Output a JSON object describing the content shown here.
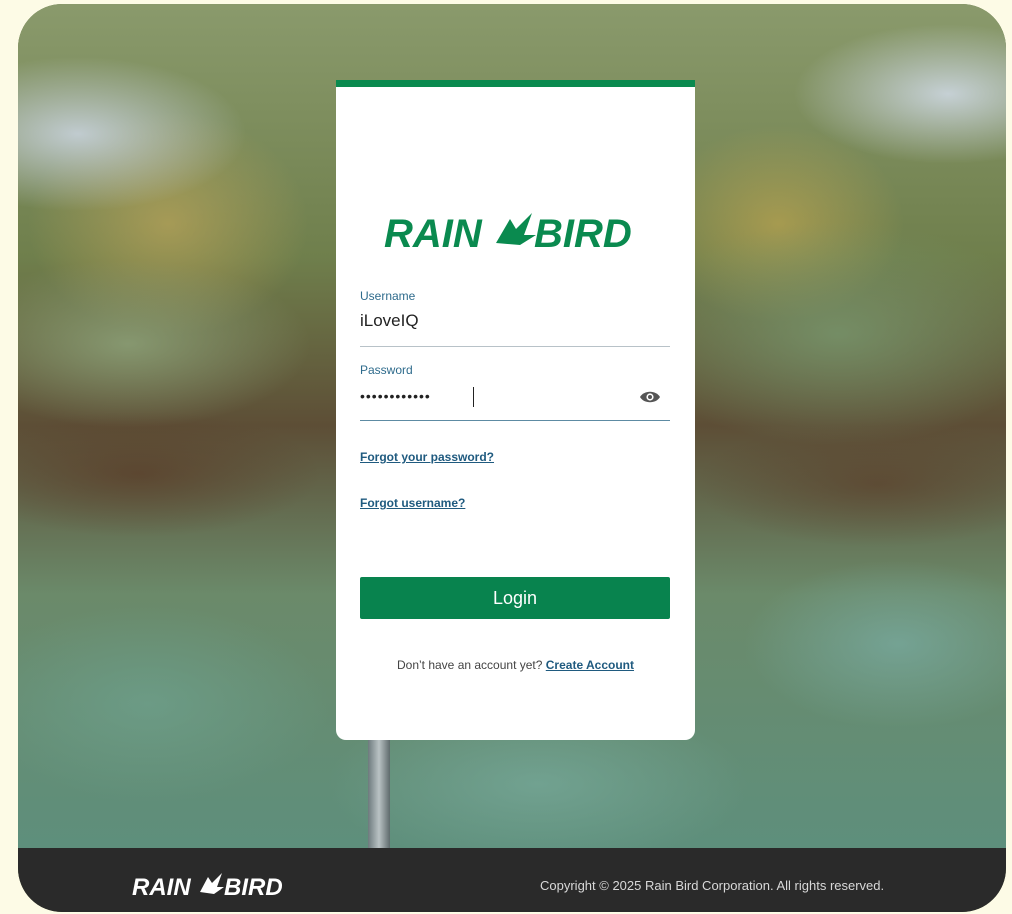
{
  "brand": {
    "name": "RAIN BIRD",
    "accent": "#0a8a4f",
    "button_color": "#08834e",
    "link_color": "#1f5a7f"
  },
  "login_card": {
    "username_label": "Username",
    "username_value": "iLoveIQ",
    "password_label": "Password",
    "password_mask": "••••••••••••",
    "forgot_password": "Forgot your password?",
    "forgot_username": "Forgot username?",
    "login_button": "Login",
    "no_account_text": "Don’t have an account yet?",
    "create_account": "Create Account"
  },
  "footer": {
    "brand_name": "RAIN BIRD",
    "copyright": "Copyright © 2025 Rain Bird Corporation. All rights reserved."
  },
  "icons": {
    "password_toggle": "eye-icon",
    "logo": "rain-bird-logo"
  }
}
